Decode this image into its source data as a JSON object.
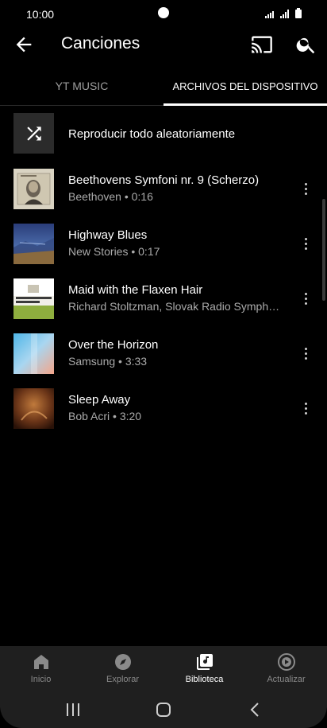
{
  "status_bar": {
    "time": "10:00"
  },
  "app_bar": {
    "title": "Canciones"
  },
  "tabs": [
    {
      "label": "YT MUSIC",
      "active": false
    },
    {
      "label": "ARCHIVOS DEL DISPOSITIVO",
      "active": true
    }
  ],
  "shuffle": {
    "label": "Reproducir todo aleatoriamente",
    "icon": "shuffle-icon"
  },
  "songs": [
    {
      "title": "Beethovens Symfoni nr. 9 (Scherzo)",
      "subtitle": "Beethoven • 0:16"
    },
    {
      "title": "Highway Blues",
      "subtitle": "New Stories • 0:17"
    },
    {
      "title": "Maid with the Flaxen Hair",
      "subtitle": "Richard Stoltzman, Slovak Radio Symph…"
    },
    {
      "title": "Over the Horizon",
      "subtitle": "Samsung • 3:33"
    },
    {
      "title": "Sleep Away",
      "subtitle": "Bob Acri • 3:20"
    }
  ],
  "bottom_nav": [
    {
      "label": "Inicio",
      "icon": "home-icon",
      "active": false
    },
    {
      "label": "Explorar",
      "icon": "compass-icon",
      "active": false
    },
    {
      "label": "Biblioteca",
      "icon": "library-icon",
      "active": true
    },
    {
      "label": "Actualizar",
      "icon": "upgrade-icon",
      "active": false
    }
  ],
  "colors": {
    "background": "#000000",
    "nav_background": "#1f1f1f",
    "secondary_text": "#aaaaaa",
    "accent": "#ffffff"
  }
}
